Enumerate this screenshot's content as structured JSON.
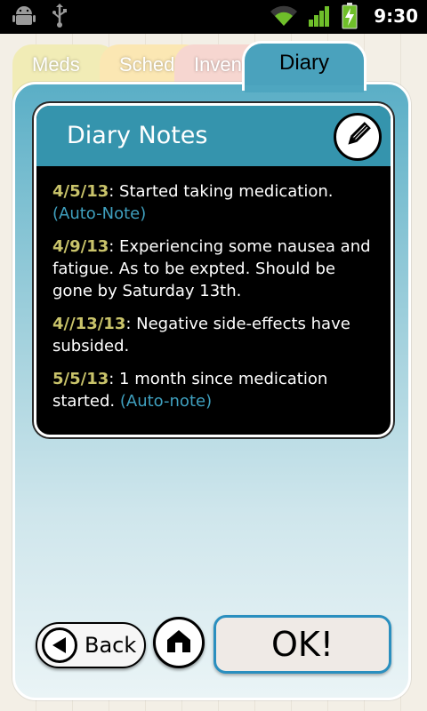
{
  "status_bar": {
    "time": "9:30",
    "icons": [
      "android-debug-icon",
      "usb-icon",
      "wifi-icon",
      "signal-icon",
      "battery-charging-icon"
    ]
  },
  "tabs": [
    {
      "label": "Meds",
      "active": false
    },
    {
      "label": "Sched",
      "active": false
    },
    {
      "label": "Inven",
      "active": false
    },
    {
      "label": "Diary",
      "active": true
    }
  ],
  "card": {
    "title": "Diary Notes",
    "edit_icon": "pencil-icon"
  },
  "notes": [
    {
      "date": "4/5/13",
      "text": ": Started taking medication. ",
      "auto": "(Auto-Note)"
    },
    {
      "date": "4/9/13",
      "text": ": Experiencing some nausea and fatigue. As to be expted. Should be gone by Saturday 13th.",
      "auto": ""
    },
    {
      "date": "4//13/13",
      "text": ": Negative side-effects have subsided.",
      "auto": ""
    },
    {
      "date": "5/5/13",
      "text": ": 1 month since medication started. ",
      "auto": "(Auto-note)"
    }
  ],
  "buttons": {
    "back_label": "Back",
    "ok_label": "OK!"
  },
  "colors": {
    "panel_top": "#5aaec6",
    "header": "#3594ad",
    "date": "#c9c36a",
    "auto_note": "#3fa0bf",
    "ok_border": "#2a8fbf"
  }
}
